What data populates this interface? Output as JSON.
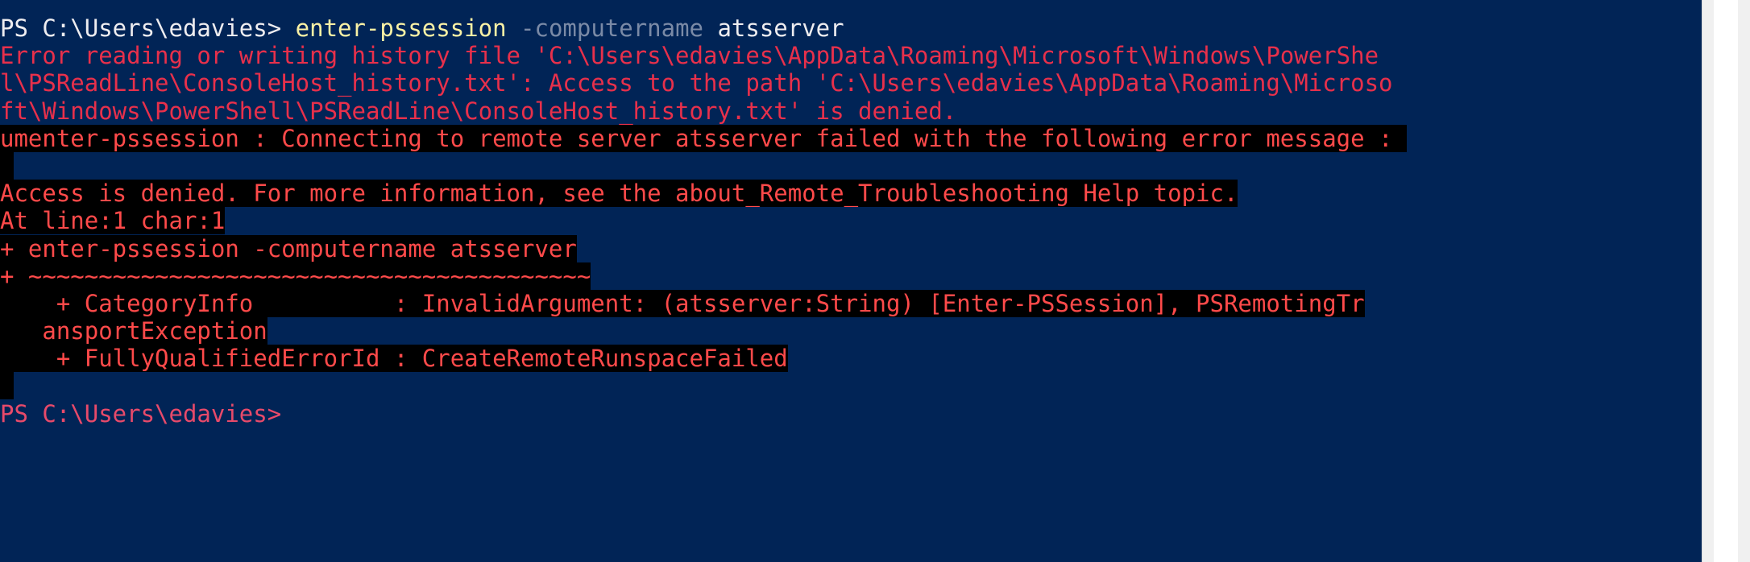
{
  "console": {
    "background": "#012456",
    "lines": [
      {
        "segments": [
          {
            "text": "PS C:\\Users\\edavies> ",
            "style": "prompt"
          },
          {
            "text": "enter-pssession",
            "style": "cmd"
          },
          {
            "text": " -computername",
            "style": "param"
          },
          {
            "text": " atsserver",
            "style": "arg"
          }
        ]
      },
      {
        "segments": [
          {
            "text": "Error reading or writing history file 'C:\\Users\\edavies\\AppData\\Roaming\\Microsoft\\Windows\\PowerShe",
            "style": "warn"
          }
        ]
      },
      {
        "segments": [
          {
            "text": "l\\PSReadLine\\ConsoleHost_history.txt': Access to the path 'C:\\Users\\edavies\\AppData\\Roaming\\Microso",
            "style": "warn"
          }
        ]
      },
      {
        "segments": [
          {
            "text": "ft\\Windows\\PowerShell\\PSReadLine\\ConsoleHost_history.txt' is denied.",
            "style": "warn"
          }
        ]
      },
      {
        "segments": [
          {
            "text": "umenter-pssession : Connecting to remote server atsserver failed with the following error message : ",
            "style": "err"
          }
        ]
      },
      {
        "segments": [
          {
            "text": " ",
            "style": "err"
          }
        ]
      },
      {
        "segments": [
          {
            "text": "Access is denied. For more information, see the about_Remote_Troubleshooting Help topic.",
            "style": "err"
          }
        ]
      },
      {
        "segments": [
          {
            "text": "At line:1 char:1",
            "style": "err"
          }
        ]
      },
      {
        "segments": [
          {
            "text": "+ enter-pssession -computername atsserver",
            "style": "err"
          }
        ]
      },
      {
        "segments": [
          {
            "text": "+ ~~~~~~~~~~~~~~~~~~~~~~~~~~~~~~~~~~~~~~~~",
            "style": "err"
          }
        ]
      },
      {
        "segments": [
          {
            "text": "    + CategoryInfo          : InvalidArgument: (atsserver:String) [Enter-PSSession], PSRemotingTr",
            "style": "err"
          }
        ]
      },
      {
        "segments": [
          {
            "text": "   ansportException",
            "style": "err"
          }
        ]
      },
      {
        "segments": [
          {
            "text": "    + FullyQualifiedErrorId : CreateRemoteRunspaceFailed",
            "style": "err"
          }
        ]
      },
      {
        "segments": [
          {
            "text": " ",
            "style": "err"
          }
        ]
      },
      {
        "segments": [
          {
            "text": "PS C:\\Users\\edavies>",
            "style": "prompt2"
          }
        ]
      }
    ]
  }
}
